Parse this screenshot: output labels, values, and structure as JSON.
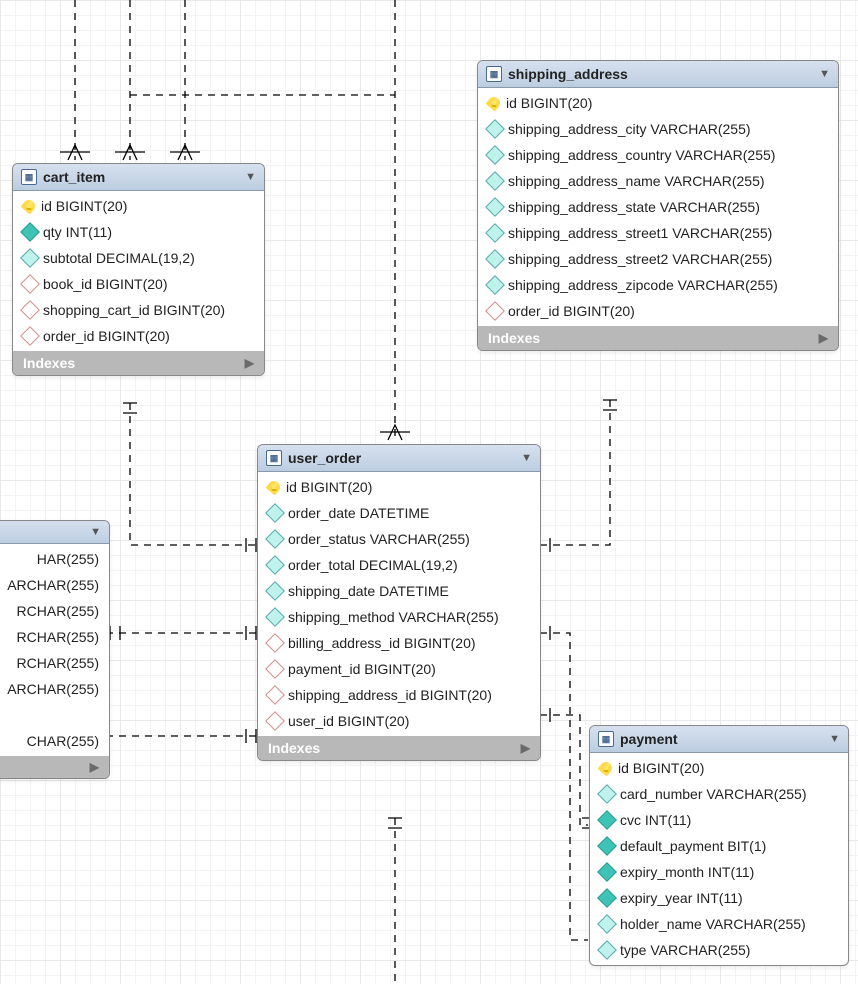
{
  "indexes_label": "Indexes",
  "entities": {
    "cart_item": {
      "title": "cart_item",
      "columns": [
        {
          "icon": "key",
          "text": "id BIGINT(20)"
        },
        {
          "icon": "dia solid",
          "text": "qty INT(11)"
        },
        {
          "icon": "dia",
          "text": "subtotal DECIMAL(19,2)"
        },
        {
          "icon": "dia fk",
          "text": "book_id BIGINT(20)"
        },
        {
          "icon": "dia fk",
          "text": "shopping_cart_id BIGINT(20)"
        },
        {
          "icon": "dia fk",
          "text": "order_id BIGINT(20)"
        }
      ]
    },
    "shipping_address": {
      "title": "shipping_address",
      "columns": [
        {
          "icon": "key",
          "text": "id BIGINT(20)"
        },
        {
          "icon": "dia",
          "text": "shipping_address_city VARCHAR(255)"
        },
        {
          "icon": "dia",
          "text": "shipping_address_country VARCHAR(255)"
        },
        {
          "icon": "dia",
          "text": "shipping_address_name VARCHAR(255)"
        },
        {
          "icon": "dia",
          "text": "shipping_address_state VARCHAR(255)"
        },
        {
          "icon": "dia",
          "text": "shipping_address_street1 VARCHAR(255)"
        },
        {
          "icon": "dia",
          "text": "shipping_address_street2 VARCHAR(255)"
        },
        {
          "icon": "dia",
          "text": "shipping_address_zipcode VARCHAR(255)"
        },
        {
          "icon": "dia fk",
          "text": "order_id BIGINT(20)"
        }
      ]
    },
    "user_order": {
      "title": "user_order",
      "columns": [
        {
          "icon": "key",
          "text": "id BIGINT(20)"
        },
        {
          "icon": "dia",
          "text": "order_date DATETIME"
        },
        {
          "icon": "dia",
          "text": "order_status VARCHAR(255)"
        },
        {
          "icon": "dia",
          "text": "order_total DECIMAL(19,2)"
        },
        {
          "icon": "dia",
          "text": "shipping_date DATETIME"
        },
        {
          "icon": "dia",
          "text": "shipping_method VARCHAR(255)"
        },
        {
          "icon": "dia fk",
          "text": "billing_address_id BIGINT(20)"
        },
        {
          "icon": "dia fk",
          "text": "payment_id BIGINT(20)"
        },
        {
          "icon": "dia fk",
          "text": "shipping_address_id BIGINT(20)"
        },
        {
          "icon": "dia fk",
          "text": "user_id BIGINT(20)"
        }
      ]
    },
    "payment": {
      "title": "payment",
      "columns": [
        {
          "icon": "key",
          "text": "id BIGINT(20)"
        },
        {
          "icon": "dia",
          "text": "card_number VARCHAR(255)"
        },
        {
          "icon": "dia solid",
          "text": "cvc INT(11)"
        },
        {
          "icon": "dia solid",
          "text": "default_payment BIT(1)"
        },
        {
          "icon": "dia solid",
          "text": "expiry_month INT(11)"
        },
        {
          "icon": "dia solid",
          "text": "expiry_year INT(11)"
        },
        {
          "icon": "dia",
          "text": "holder_name VARCHAR(255)"
        },
        {
          "icon": "dia",
          "text": "type VARCHAR(255)"
        }
      ]
    },
    "left_partial": {
      "columns_text": [
        "HAR(255)",
        "ARCHAR(255)",
        "RCHAR(255)",
        "RCHAR(255)",
        "RCHAR(255)",
        "ARCHAR(255)",
        "",
        "CHAR(255)"
      ]
    }
  }
}
